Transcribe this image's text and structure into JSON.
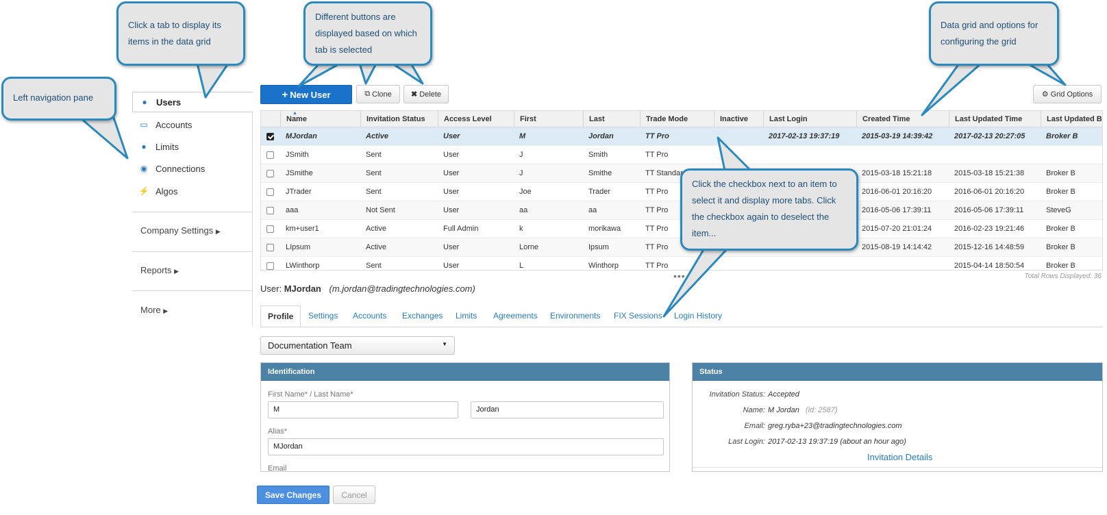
{
  "sidebar": {
    "items": [
      {
        "label": "Users",
        "icon": "user-icon",
        "active": true
      },
      {
        "label": "Accounts",
        "icon": "inbox-icon"
      },
      {
        "label": "Limits",
        "icon": "user-icon"
      },
      {
        "label": "Connections",
        "icon": "globe-icon"
      },
      {
        "label": "Algos",
        "icon": "bolt-icon"
      }
    ],
    "groups": [
      "Company Settings",
      "Reports",
      "More"
    ]
  },
  "toolbar": {
    "new_user": "New User",
    "clone": "Clone",
    "delete": "Delete",
    "grid_options": "Grid Options"
  },
  "grid": {
    "columns": [
      "Name",
      "Invitation Status",
      "Access Level",
      "First",
      "Last",
      "Trade Mode",
      "Inactive",
      "Last Login",
      "Created Time",
      "Last Updated Time",
      "Last Updated By"
    ],
    "rows": [
      {
        "checked": true,
        "cells": [
          "MJordan",
          "Active",
          "User",
          "M",
          "Jordan",
          "TT Pro",
          "",
          "2017-02-13 19:37:19",
          "2015-03-19 14:39:42",
          "2017-02-13 20:27:05",
          "Broker B"
        ]
      },
      {
        "checked": false,
        "cells": [
          "JSmith",
          "Sent",
          "User",
          "J",
          "Smith",
          "TT Pro",
          "",
          "",
          "",
          "",
          ""
        ]
      },
      {
        "checked": false,
        "cells": [
          "JSmithe",
          "Sent",
          "User",
          "J",
          "Smithe",
          "TT Standard (I",
          "",
          "",
          "2015-03-18 15:21:18",
          "2015-03-18 15:21:38",
          "Broker B"
        ]
      },
      {
        "checked": false,
        "cells": [
          "JTrader",
          "Sent",
          "User",
          "Joe",
          "Trader",
          "TT Pro",
          "",
          "",
          "2016-06-01 20:16:20",
          "2016-06-01 20:16:20",
          "Broker B"
        ]
      },
      {
        "checked": false,
        "cells": [
          "aaa",
          "Not Sent",
          "User",
          "aa",
          "aa",
          "TT Pro",
          "",
          "",
          "2016-05-06 17:39:11",
          "2016-05-06 17:39:11",
          "SteveG"
        ]
      },
      {
        "checked": false,
        "cells": [
          "km+user1",
          "Active",
          "Full Admin",
          "k",
          "morikawa",
          "TT Pro",
          "",
          "",
          "2015-07-20 21:01:24",
          "2016-02-23 19:21:46",
          "Broker B"
        ]
      },
      {
        "checked": false,
        "cells": [
          "LIpsum",
          "Active",
          "User",
          "Lorne",
          "Ipsum",
          "TT Pro",
          "",
          "",
          "2015-08-19 14:14:42",
          "2015-12-16 14:48:59",
          "Broker B"
        ]
      },
      {
        "checked": false,
        "cells": [
          "LWinthorp",
          "Sent",
          "User",
          "L",
          "Winthorp",
          "TT Pro",
          "",
          "",
          "",
          "2015-04-14 18:50:54",
          "Broker B"
        ]
      }
    ],
    "total_rows": "Total Rows Displayed: 36"
  },
  "detail": {
    "user_prefix": "User:",
    "user_name": "MJordan",
    "user_email": "(m.jordan@tradingtechnologies.com)",
    "tabs": [
      "Profile",
      "Settings",
      "Accounts",
      "Exchanges",
      "Limits",
      "Agreements",
      "Environments",
      "FIX Sessions",
      "Login History"
    ],
    "team": "Documentation Team",
    "identification": {
      "title": "Identification",
      "name_label": "First Name* / Last Name*",
      "first_name": "M",
      "last_name": "Jordan",
      "alias_label": "Alias*",
      "alias": "MJordan",
      "email_label": "Email"
    },
    "status": {
      "title": "Status",
      "invitation_label": "Invitation Status:",
      "invitation_value": "Accepted",
      "name_label": "Name:",
      "name_value": "M Jordan",
      "name_id": "(id: 2587)",
      "email_label": "Email:",
      "email_value": "greg.ryba+23@tradingtechnologies.com",
      "last_login_label": "Last Login:",
      "last_login_value": "2017-02-13 19:37:19 (about an hour ago)",
      "details_link": "Invitation Details"
    },
    "save": "Save Changes",
    "cancel": "Cancel"
  },
  "callouts": {
    "left_nav": "Left navigation pane",
    "tab": "Click a tab to display its items in the data grid",
    "buttons": "Different buttons are displayed based on which tab is selected",
    "grid": "Data grid and options for configuring the grid",
    "checkbox": "Click the checkbox next to an item to select it and display more tabs. Click the checkbox again to deselect the item..."
  },
  "colors": {
    "primary": "#1a73c9",
    "panel_header": "#4c82a6",
    "callout_border": "#2c89bb",
    "link": "#2a7ab8"
  }
}
